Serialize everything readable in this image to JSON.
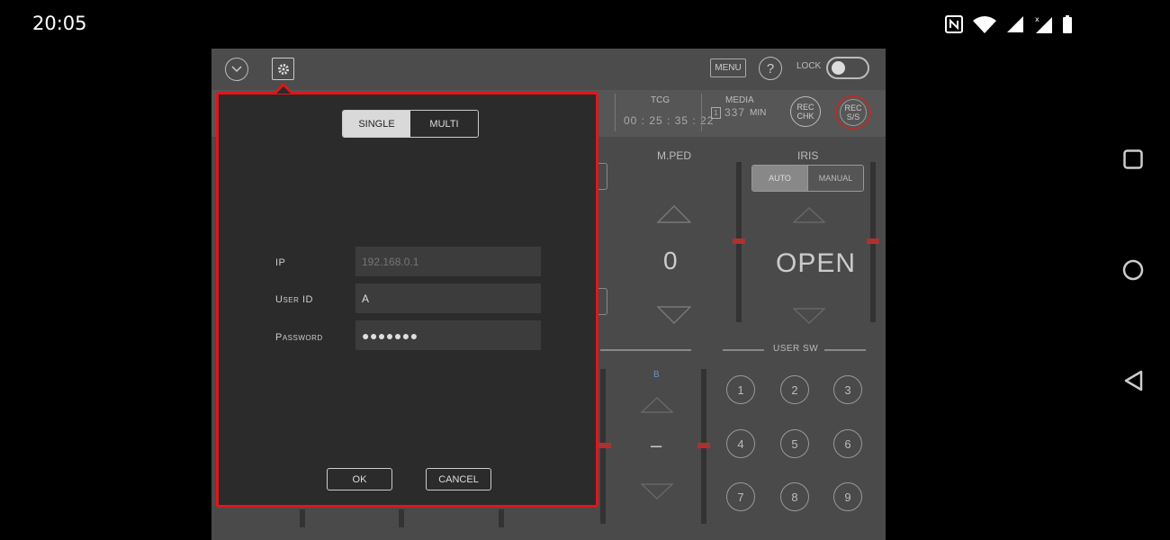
{
  "status_bar": {
    "time": "20:05",
    "icons": [
      "nfc-icon",
      "wifi-icon",
      "signal-icon",
      "signal-x-icon",
      "battery-icon"
    ]
  },
  "app": {
    "toolbar": {
      "menu_label": "MENU",
      "help_label": "?",
      "lock_label": "LOCK"
    },
    "info": {
      "tcg_label": "TCG",
      "tcg_value": "00 : 25 : 35 : 22",
      "media_label": "MEDIA",
      "media_slot": "1",
      "media_value": "337",
      "media_unit": "MIN",
      "rec_chk_line1": "REC",
      "rec_chk_line2": "CHK",
      "rec_ss_line1": "REC",
      "rec_ss_line2": "S/S"
    },
    "mped": {
      "label": "M.PED",
      "value": "0"
    },
    "iris": {
      "label": "IRIS",
      "auto": "AUTO",
      "manual": "MANUAL",
      "value": "OPEN"
    },
    "b_panel": {
      "label": "B",
      "value": "–"
    },
    "user_sw": {
      "label": "USER SW",
      "buttons": [
        "1",
        "2",
        "3",
        "4",
        "5",
        "6",
        "7",
        "8",
        "9"
      ]
    }
  },
  "dialog": {
    "tabs": {
      "single": "SINGLE",
      "multi": "MULTI"
    },
    "ip_label": "IP",
    "ip_placeholder": "192.168.0.1",
    "user_id_label": "User ID",
    "user_id_value": "A",
    "password_label": "Password",
    "password_value": "●●●●●●●",
    "ok_label": "OK",
    "cancel_label": "CANCEL",
    "border_color": "#e0161b"
  }
}
